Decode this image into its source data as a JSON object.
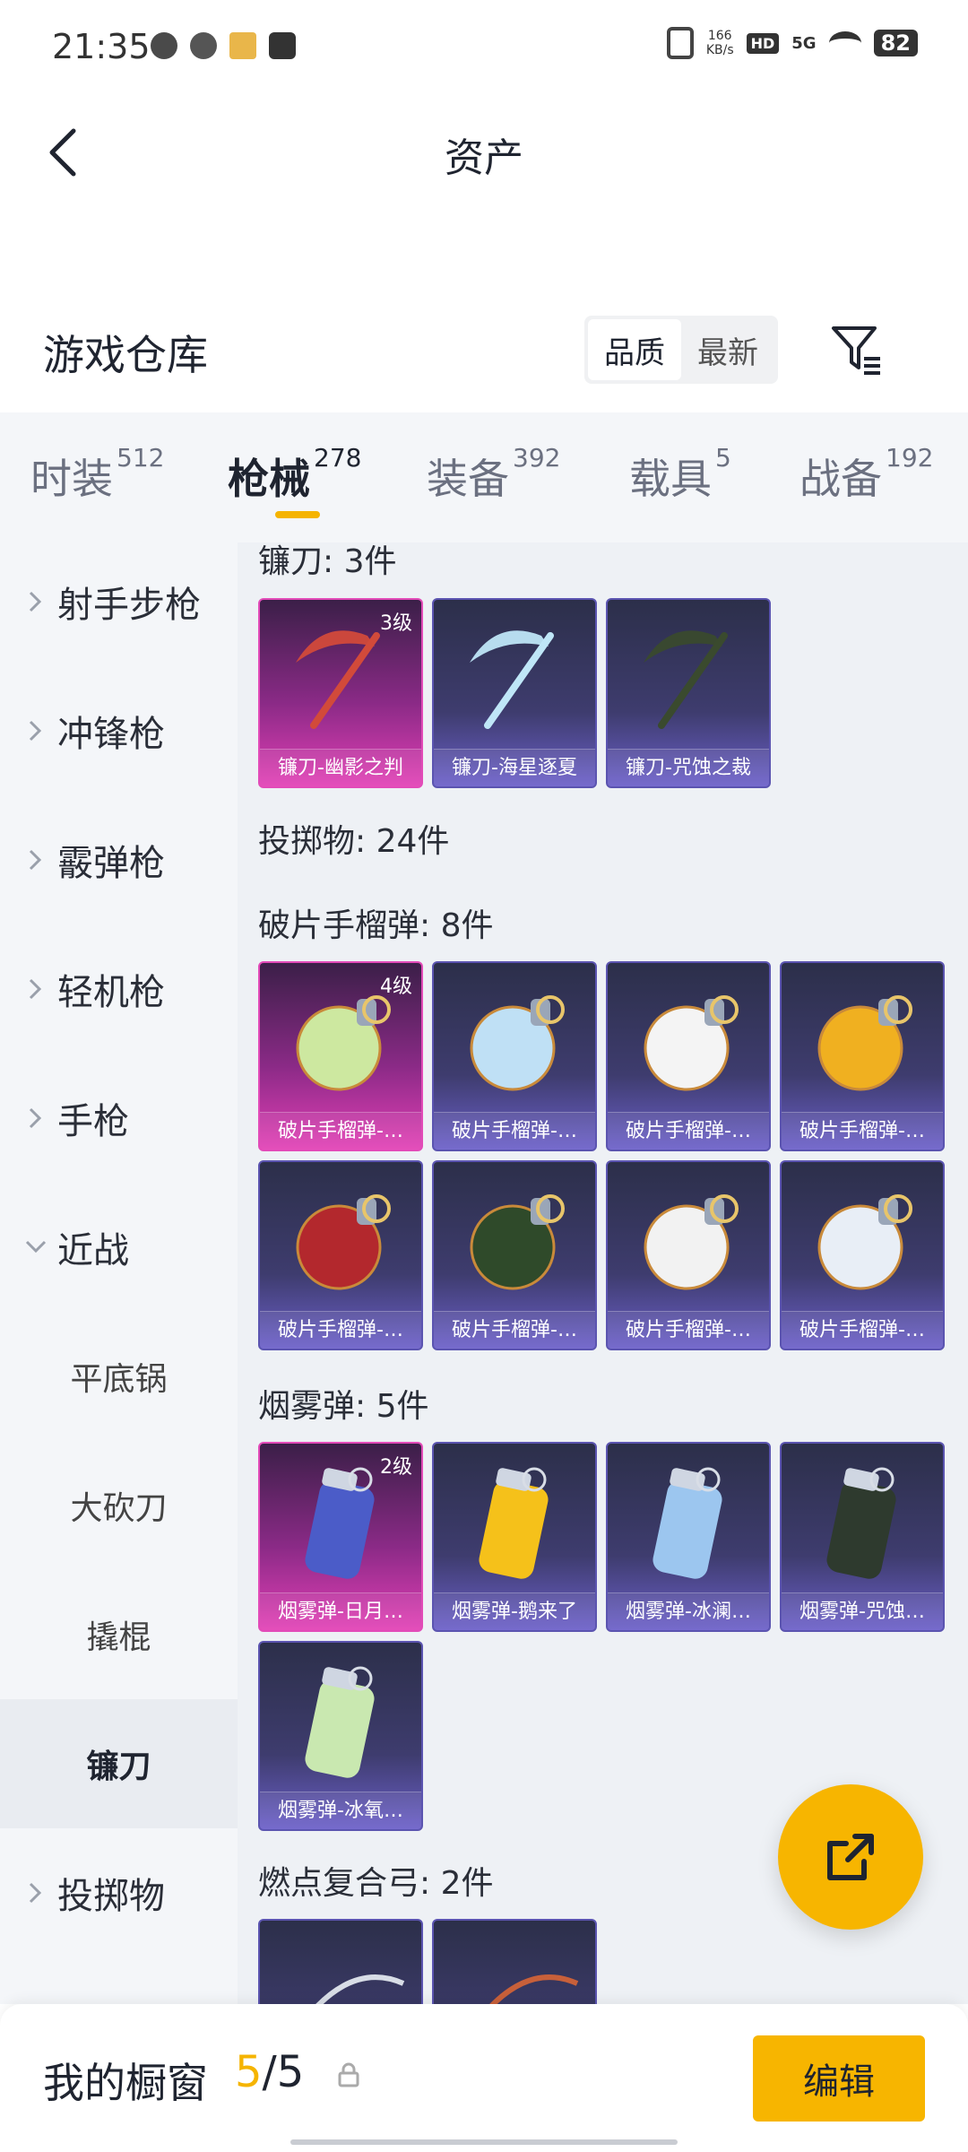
{
  "status_bar": {
    "time": "21:35",
    "speed_value": "166",
    "speed_unit": "KB/s",
    "hd": "HD",
    "network": "5G",
    "battery": "82"
  },
  "header": {
    "title": "资产"
  },
  "warehouse": {
    "title": "游戏仓库",
    "sort_options": [
      "品质",
      "最新"
    ],
    "sort_selected": "品质"
  },
  "tabs": [
    {
      "label": "时装",
      "count": "512"
    },
    {
      "label": "枪械",
      "count": "278",
      "active": true
    },
    {
      "label": "装备",
      "count": "392"
    },
    {
      "label": "载具",
      "count": "5"
    },
    {
      "label": "战备",
      "count": "192"
    }
  ],
  "sidebar": [
    {
      "label": "射手步枪",
      "type": "collapsed"
    },
    {
      "label": "冲锋枪",
      "type": "collapsed"
    },
    {
      "label": "霰弹枪",
      "type": "collapsed"
    },
    {
      "label": "轻机枪",
      "type": "collapsed"
    },
    {
      "label": "手枪",
      "type": "collapsed"
    },
    {
      "label": "近战",
      "type": "expanded"
    },
    {
      "label": "平底锅",
      "type": "sub"
    },
    {
      "label": "大砍刀",
      "type": "sub"
    },
    {
      "label": "撬棍",
      "type": "sub"
    },
    {
      "label": "镰刀",
      "type": "sub",
      "selected": true
    },
    {
      "label": "投掷物",
      "type": "collapsed"
    }
  ],
  "sections": [
    {
      "title": "镰刀: 3件",
      "items": [
        {
          "name": "镰刀-幽影之判",
          "level": "3级",
          "rarity": "pink"
        },
        {
          "name": "镰刀-海星逐夏",
          "rarity": "purple"
        },
        {
          "name": "镰刀-咒蚀之裁",
          "rarity": "purple"
        }
      ]
    },
    {
      "title": "投掷物: 24件",
      "items": []
    },
    {
      "title": "破片手榴弹: 8件",
      "items": [
        {
          "name": "破片手榴弹-…",
          "level": "4级",
          "rarity": "pink"
        },
        {
          "name": "破片手榴弹-…",
          "rarity": "purple"
        },
        {
          "name": "破片手榴弹-…",
          "rarity": "purple"
        },
        {
          "name": "破片手榴弹-…",
          "rarity": "purple"
        },
        {
          "name": "破片手榴弹-…",
          "rarity": "purple"
        },
        {
          "name": "破片手榴弹-…",
          "rarity": "purple"
        },
        {
          "name": "破片手榴弹-…",
          "rarity": "purple"
        },
        {
          "name": "破片手榴弹-…",
          "rarity": "purple"
        }
      ]
    },
    {
      "title": "烟雾弹: 5件",
      "items": [
        {
          "name": "烟雾弹-日月…",
          "level": "2级",
          "rarity": "pink"
        },
        {
          "name": "烟雾弹-鹅来了",
          "rarity": "purple"
        },
        {
          "name": "烟雾弹-冰澜…",
          "rarity": "purple"
        },
        {
          "name": "烟雾弹-咒蚀…",
          "rarity": "purple"
        },
        {
          "name": "烟雾弹-冰氧…",
          "rarity": "purple"
        }
      ]
    },
    {
      "title": "燃点复合弓: 2件",
      "items": [
        {
          "name": "",
          "rarity": "purple"
        },
        {
          "name": "",
          "rarity": "purple"
        }
      ]
    }
  ],
  "showcase": {
    "title": "我的橱窗",
    "current": "5",
    "separator": "/",
    "total": "5",
    "edit_label": "编辑"
  },
  "colors": {
    "accent": "#f7b500",
    "rarity_pink": "#e23fb5",
    "rarity_purple": "#6b5fc9"
  }
}
